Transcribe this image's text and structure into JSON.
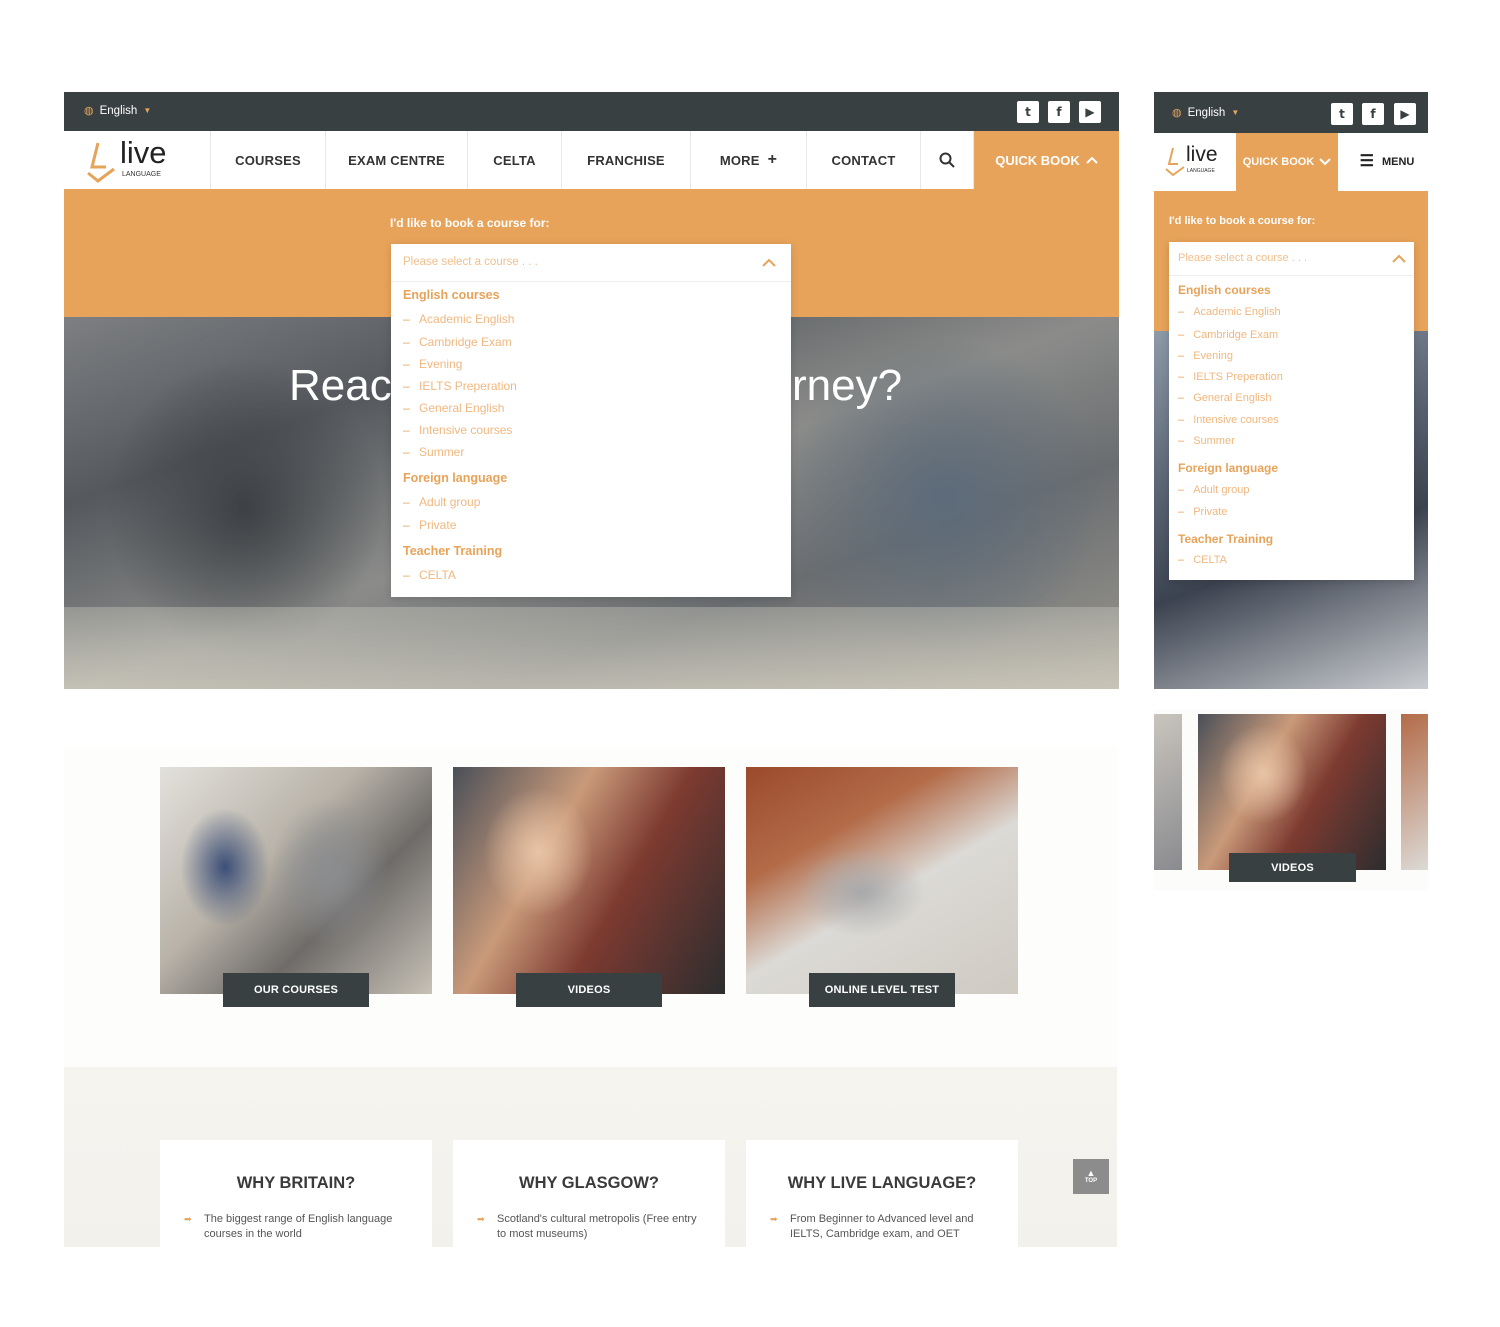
{
  "desktop": {
    "topbar": {
      "language": "English"
    },
    "logo": {
      "word": "live",
      "sub": "LANGUAGE"
    },
    "nav": [
      {
        "label": "COURSES"
      },
      {
        "label": "EXAM CENTRE"
      },
      {
        "label": "CELTA"
      },
      {
        "label": "FRANCHISE"
      },
      {
        "label": "MORE"
      },
      {
        "label": "CONTACT"
      }
    ],
    "quick_book": "QUICK BOOK",
    "booking": {
      "prompt": "I'd like to book a course for:",
      "placeholder": "Please select a course . . .",
      "groups": [
        {
          "name": "English courses",
          "options": [
            "Academic English",
            "Cambridge Exam",
            "Evening",
            "IELTS Preperation",
            "General English",
            "Intensive courses",
            "Summer"
          ]
        },
        {
          "name": "Foreign language",
          "options": [
            "Adult group",
            "Private"
          ]
        },
        {
          "name": "Teacher Training",
          "options": [
            "CELTA"
          ]
        }
      ]
    },
    "hero": {
      "left": "Reac",
      "right": "rney?"
    },
    "tiles": [
      {
        "label": "OUR COURSES"
      },
      {
        "label": "VIDEOS"
      },
      {
        "label": "ONLINE LEVEL TEST"
      }
    ],
    "why": [
      {
        "title": "WHY BRITAIN?",
        "text": "The biggest range of English language courses in the world"
      },
      {
        "title": "WHY GLASGOW?",
        "text": "Scotland's cultural metropolis (Free entry to most museums)"
      },
      {
        "title": "WHY LIVE LANGUAGE?",
        "text": "From Beginner to Advanced level and IELTS, Cambridge exam, and OET"
      }
    ],
    "top_button": "TOP"
  },
  "mobile": {
    "language": "English",
    "quick_book": "QUICK BOOK",
    "menu": "MENU",
    "tile": "VIDEOS"
  },
  "icons": [
    "globe-icon",
    "twitter-icon",
    "facebook-icon",
    "youtube-icon",
    "search-icon",
    "chevron-up-icon",
    "chevron-down-icon",
    "plus-icon",
    "menu-icon",
    "arrow-icon"
  ],
  "colors": {
    "accent": "#e7a35a",
    "dark": "#394042"
  }
}
